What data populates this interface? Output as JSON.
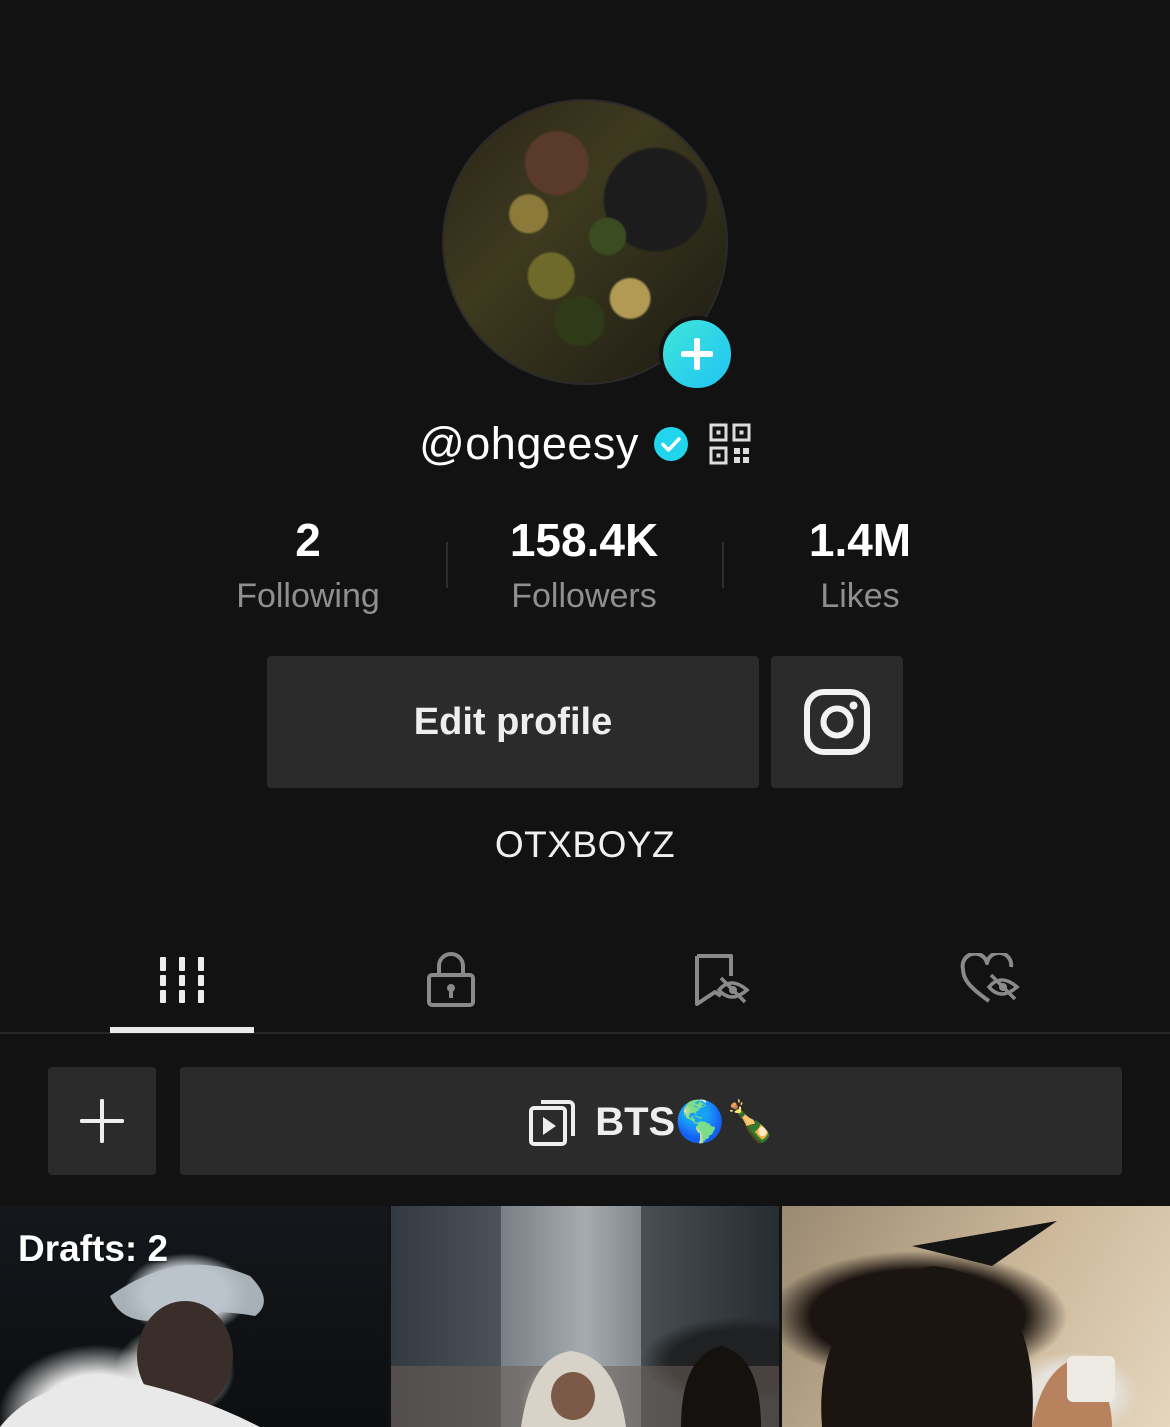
{
  "profile": {
    "username": "@ohgeesy",
    "verified": true,
    "bio": "OTXBOYZ"
  },
  "stats": [
    {
      "value": "2",
      "label": "Following"
    },
    {
      "value": "158.4K",
      "label": "Followers"
    },
    {
      "value": "1.4M",
      "label": "Likes"
    }
  ],
  "buttons": {
    "edit_profile": "Edit profile"
  },
  "tabs": [
    {
      "icon": "videos-grid-icon",
      "active": true
    },
    {
      "icon": "lock-icon",
      "active": false
    },
    {
      "icon": "saved-hidden-icon",
      "active": false
    },
    {
      "icon": "liked-hidden-icon",
      "active": false
    }
  ],
  "playlist": {
    "label": "BTS🌎🍾"
  },
  "videos": {
    "drafts_label": "Drafts: 2"
  },
  "colors": {
    "background": "#121212",
    "surface": "#2b2b2b",
    "accent_teal": "#20c4f4",
    "verified_blue": "#20d5ec",
    "muted_text": "#8f8f8f"
  }
}
